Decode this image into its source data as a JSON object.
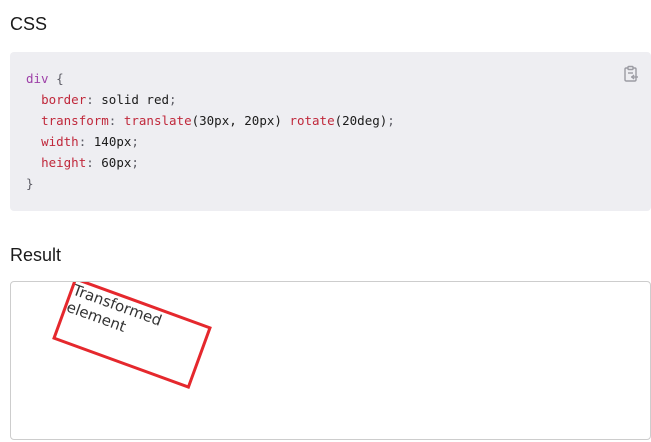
{
  "sections": {
    "css_heading": "CSS",
    "result_heading": "Result"
  },
  "code": {
    "selector": "div",
    "open_brace": " {",
    "close_brace": "}",
    "declarations": [
      {
        "property": "border",
        "value": "solid red"
      },
      {
        "property": "transform",
        "fn1": "translate",
        "args1": "(30px, 20px)",
        "fn2": "rotate",
        "args2": "(20deg)"
      },
      {
        "property": "width",
        "value": "140px"
      },
      {
        "property": "height",
        "value": "60px"
      }
    ]
  },
  "copy_button": {
    "icon": "clipboard-copy-icon"
  },
  "result": {
    "element_text": "Transformed element"
  },
  "colors": {
    "code_background": "#eeeef2",
    "demo_border": "#e5282d"
  }
}
